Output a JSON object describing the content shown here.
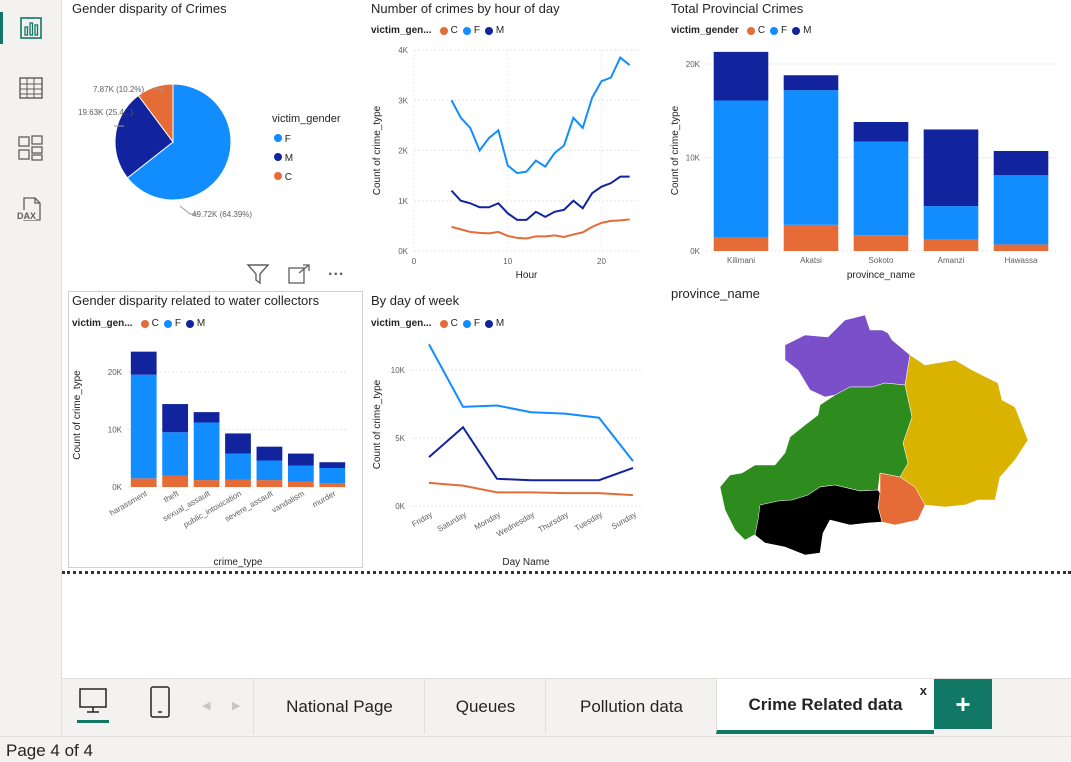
{
  "colors": {
    "C": "#e66c37",
    "F": "#118dff",
    "M": "#12239e",
    "accent": "#117865"
  },
  "nav": {
    "icons": [
      "report-view-icon",
      "table-view-icon",
      "model-view-icon",
      "dax-query-icon"
    ],
    "dax_label": "DAX"
  },
  "visuals": {
    "gender_pie": {
      "title": "Gender disparity of Crimes",
      "legend_title": "victim_gender",
      "legend_items": [
        "F",
        "M",
        "C"
      ],
      "slice_labels": [
        "49.72K (64.39%)",
        "19.63K (25.4...)",
        "7.87K (10.2%)"
      ]
    },
    "by_hour": {
      "title": "Number of crimes by hour of day",
      "legend_title": "victim_gen...",
      "legend_items": [
        "C",
        "F",
        "M"
      ]
    },
    "provincial": {
      "title": "Total Provincial Crimes",
      "legend_title": "victim_gender",
      "legend_items": [
        "C",
        "F",
        "M"
      ]
    },
    "water": {
      "title": "Gender disparity related to water collectors",
      "legend_title": "victim_gen...",
      "legend_items": [
        "C",
        "F",
        "M"
      ]
    },
    "by_day": {
      "title": "By day of week",
      "legend_title": "victim_gen...",
      "legend_items": [
        "C",
        "F",
        "M"
      ]
    },
    "map": {
      "title": "province_name",
      "region_colors": [
        "#7b4fc9",
        "#d9b300",
        "#2e8b1e",
        "#e66c37",
        "#000000"
      ]
    }
  },
  "visual_header": {
    "icons": [
      "filter-icon",
      "focus-mode-icon",
      "more-options-icon"
    ],
    "more_label": "..."
  },
  "chart_data": [
    {
      "id": "gender_pie",
      "type": "pie",
      "labels": [
        "F",
        "M",
        "C"
      ],
      "values": [
        49720,
        19630,
        7870
      ],
      "percent": [
        64.39,
        25.4,
        10.2
      ],
      "colors": [
        "#118dff",
        "#12239e",
        "#e66c37"
      ]
    },
    {
      "id": "by_hour",
      "type": "line",
      "xlabel": "Hour",
      "ylabel": "Count of crime_type",
      "xticks": [
        "0",
        "10",
        "20"
      ],
      "xlim": [
        0,
        24
      ],
      "yticks": [
        "0K",
        "1K",
        "2K",
        "3K",
        "4K"
      ],
      "ylim": [
        0,
        4000
      ],
      "x": [
        4,
        5,
        6,
        7,
        8,
        9,
        10,
        11,
        12,
        13,
        14,
        15,
        16,
        17,
        18,
        19,
        20,
        21,
        22,
        23
      ],
      "series": [
        {
          "name": "F",
          "color": "#118dff",
          "values": [
            3000,
            2650,
            2450,
            2000,
            2250,
            2400,
            1700,
            1550,
            1580,
            1800,
            1680,
            1950,
            2100,
            2650,
            2450,
            3050,
            3380,
            3450,
            3850,
            3700
          ]
        },
        {
          "name": "M",
          "color": "#12239e",
          "values": [
            1200,
            1000,
            950,
            870,
            870,
            950,
            750,
            620,
            620,
            780,
            680,
            780,
            820,
            1000,
            850,
            1150,
            1280,
            1350,
            1480,
            1480
          ]
        },
        {
          "name": "C",
          "color": "#e66c37",
          "values": [
            480,
            430,
            380,
            360,
            350,
            380,
            300,
            260,
            250,
            290,
            290,
            310,
            280,
            330,
            370,
            480,
            560,
            600,
            610,
            630
          ]
        }
      ]
    },
    {
      "id": "provincial",
      "type": "bar",
      "xlabel": "province_name",
      "ylabel": "Count of crime_type",
      "categories": [
        "Kilimani",
        "Akatsi",
        "Sokoto",
        "Amanzi",
        "Hawassa"
      ],
      "yticks": [
        "0K",
        "10K",
        "20K"
      ],
      "ylim": [
        0,
        21500
      ],
      "series": [
        {
          "name": "C",
          "color": "#e66c37",
          "values": [
            1500,
            2800,
            1700,
            1200,
            700
          ]
        },
        {
          "name": "F",
          "color": "#118dff",
          "values": [
            14600,
            14400,
            10000,
            3600,
            7400
          ]
        },
        {
          "name": "M",
          "color": "#12239e",
          "values": [
            5200,
            1600,
            2100,
            8200,
            2600
          ]
        }
      ]
    },
    {
      "id": "water",
      "type": "bar",
      "xlabel": "crime_type",
      "ylabel": "Count of crime_type",
      "categories": [
        "harassment",
        "theft",
        "sexual_assault",
        "public_intoxication",
        "severe_assault",
        "vandalism",
        "murder"
      ],
      "yticks": [
        "0K",
        "10K",
        "20K"
      ],
      "ylim": [
        0,
        25000
      ],
      "series": [
        {
          "name": "C",
          "color": "#e66c37",
          "values": [
            1500,
            2000,
            1200,
            1300,
            1200,
            900,
            700
          ]
        },
        {
          "name": "F",
          "color": "#118dff",
          "values": [
            18000,
            7500,
            10000,
            4500,
            3400,
            2800,
            2600
          ]
        },
        {
          "name": "M",
          "color": "#12239e",
          "values": [
            4000,
            4900,
            1800,
            3500,
            2400,
            2100,
            1000
          ]
        }
      ]
    },
    {
      "id": "by_day",
      "type": "line",
      "xlabel": "Day Name",
      "ylabel": "Count of crime_type",
      "categories": [
        "Friday",
        "Saturday",
        "Monday",
        "Wednesday",
        "Thursday",
        "Tuesday",
        "Sunday"
      ],
      "yticks": [
        "0K",
        "5K",
        "10K"
      ],
      "ylim": [
        0,
        12000
      ],
      "series": [
        {
          "name": "F",
          "color": "#118dff",
          "values": [
            11900,
            7300,
            7400,
            6900,
            6800,
            6500,
            3300
          ]
        },
        {
          "name": "M",
          "color": "#12239e",
          "values": [
            3600,
            5800,
            2000,
            1900,
            1900,
            1900,
            2800
          ]
        },
        {
          "name": "C",
          "color": "#e66c37",
          "values": [
            1700,
            1500,
            1000,
            1000,
            950,
            950,
            800
          ]
        }
      ]
    }
  ],
  "tabs": {
    "device_icons": [
      "desktop-layout-icon",
      "mobile-layout-icon"
    ],
    "items": [
      "National Page",
      "Queues",
      "Pollution data",
      "Crime Related data"
    ],
    "close_label": "x",
    "add_label": "+"
  },
  "status": {
    "page_indicator": "Page 4 of 4"
  }
}
